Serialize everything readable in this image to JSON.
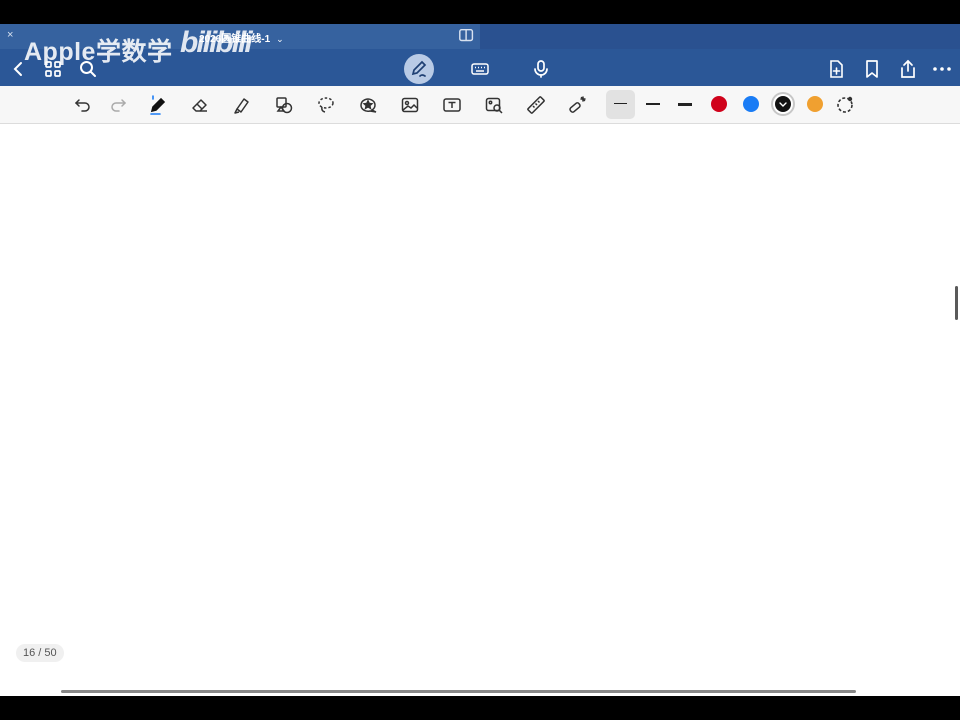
{
  "watermark": {
    "channel": "Apple学数学",
    "platform": "bilibili"
  },
  "tab": {
    "close": "×",
    "title": "2026圆锥曲线-1",
    "chevron": "⌄"
  },
  "toolbar": {
    "stroke_sizes": [
      "thin",
      "medium",
      "thick"
    ],
    "colors": [
      "#d0021b",
      "#1a7cf5",
      "#111111",
      "#f0a030"
    ],
    "selected_color": "#111111"
  },
  "footer": {
    "page_counter": "16 / 50"
  }
}
